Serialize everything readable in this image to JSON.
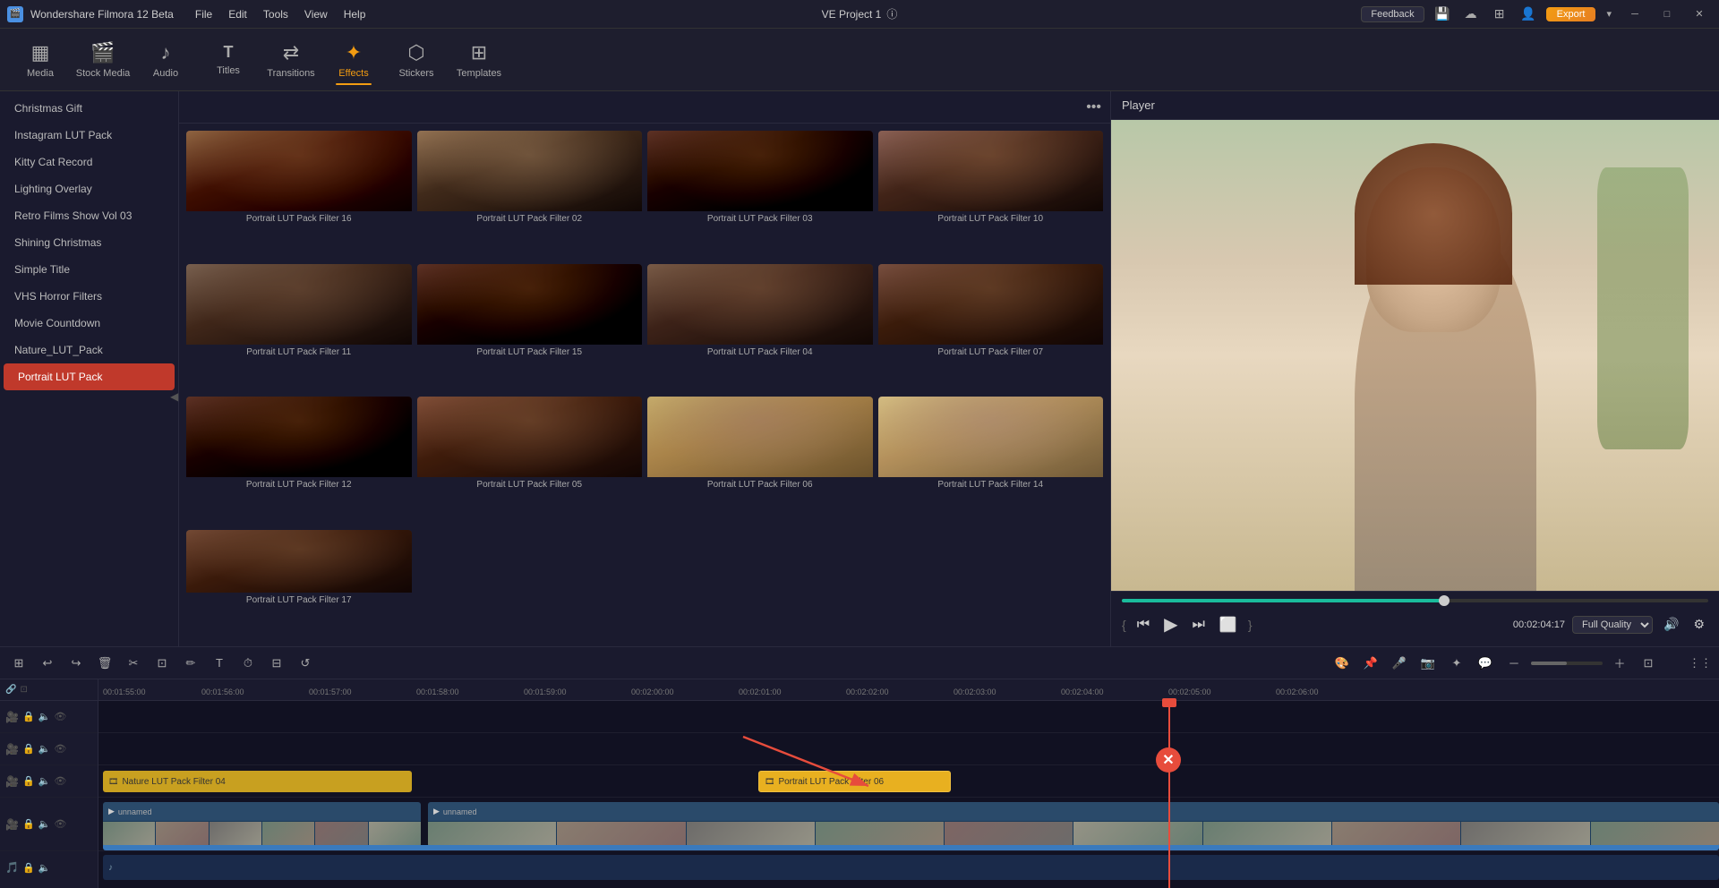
{
  "app": {
    "title": "Wondershare Filmora 12 Beta",
    "project": "VE Project 1",
    "feedback_label": "Feedback",
    "export_label": "Export"
  },
  "menu": {
    "items": [
      "File",
      "Edit",
      "Tools",
      "View",
      "Help"
    ]
  },
  "toolbar": {
    "items": [
      {
        "id": "media",
        "label": "Media",
        "icon": "▦"
      },
      {
        "id": "stock",
        "label": "Stock Media",
        "icon": "🎬"
      },
      {
        "id": "audio",
        "label": "Audio",
        "icon": "♪"
      },
      {
        "id": "titles",
        "label": "Titles",
        "icon": "T"
      },
      {
        "id": "transitions",
        "label": "Transitions",
        "icon": "⇄"
      },
      {
        "id": "effects",
        "label": "Effects",
        "icon": "✦",
        "active": true
      },
      {
        "id": "stickers",
        "label": "Stickers",
        "icon": "⬡"
      },
      {
        "id": "templates",
        "label": "Templates",
        "icon": "⊞"
      }
    ]
  },
  "left_panel": {
    "items": [
      {
        "label": "Christmas Gift"
      },
      {
        "label": "Instagram LUT Pack"
      },
      {
        "label": "Kitty Cat Record"
      },
      {
        "label": "Lighting Overlay"
      },
      {
        "label": "Retro Films Show Vol 03"
      },
      {
        "label": "Shining Christmas"
      },
      {
        "label": "Simple Title"
      },
      {
        "label": "VHS Horror Filters"
      },
      {
        "label": "Movie Countdown"
      },
      {
        "label": "Nature_LUT_Pack"
      },
      {
        "label": "Portrait LUT Pack",
        "active": true
      }
    ]
  },
  "effects_grid": {
    "items": [
      {
        "label": "Portrait LUT Pack Filter 16",
        "locked": false,
        "style": "dark"
      },
      {
        "label": "Portrait LUT Pack Filter 02",
        "locked": false,
        "style": "warm"
      },
      {
        "label": "Portrait LUT Pack Filter 03",
        "locked": false,
        "style": "dark"
      },
      {
        "label": "Portrait LUT Pack Filter 10",
        "locked": false,
        "style": "cool"
      },
      {
        "label": "Portrait LUT Pack Filter 11",
        "locked": true,
        "style": "warm"
      },
      {
        "label": "Portrait LUT Pack Filter 15",
        "locked": true,
        "style": "dark"
      },
      {
        "label": "Portrait LUT Pack Filter 04",
        "locked": true,
        "style": "cool"
      },
      {
        "label": "Portrait LUT Pack Filter 07",
        "locked": true,
        "style": "warm"
      },
      {
        "label": "Portrait LUT Pack Filter 12",
        "locked": true,
        "style": "dark"
      },
      {
        "label": "Portrait LUT Pack Filter 05",
        "locked": true,
        "style": "warm"
      },
      {
        "label": "Portrait LUT Pack Filter 06",
        "locked": true,
        "style": "bright"
      },
      {
        "label": "Portrait LUT Pack Filter 14",
        "locked": true,
        "style": "bright"
      },
      {
        "label": "Portrait LUT Pack Filter 17",
        "locked": true,
        "style": "warm"
      }
    ]
  },
  "player": {
    "title": "Player",
    "time": "00:02:04:17",
    "quality": "Full Quality",
    "seek_percent": 55
  },
  "timeline": {
    "time_markers": [
      "00:01:55:00",
      "00:01:56:00",
      "00:01:57:00",
      "00:01:58:00",
      "00:01:59:00",
      "00:02:00:00",
      "00:02:01:00",
      "00:02:02:00",
      "00:02:03:00",
      "00:02:04:00",
      "00:02:05:00",
      "00:02:06:00"
    ],
    "clips": {
      "nature_filter": "Nature LUT Pack Filter 04",
      "portrait_filter": "Portrait LUT Pack Filter 06",
      "video1": "unnamed",
      "video2": "unnamed"
    }
  }
}
